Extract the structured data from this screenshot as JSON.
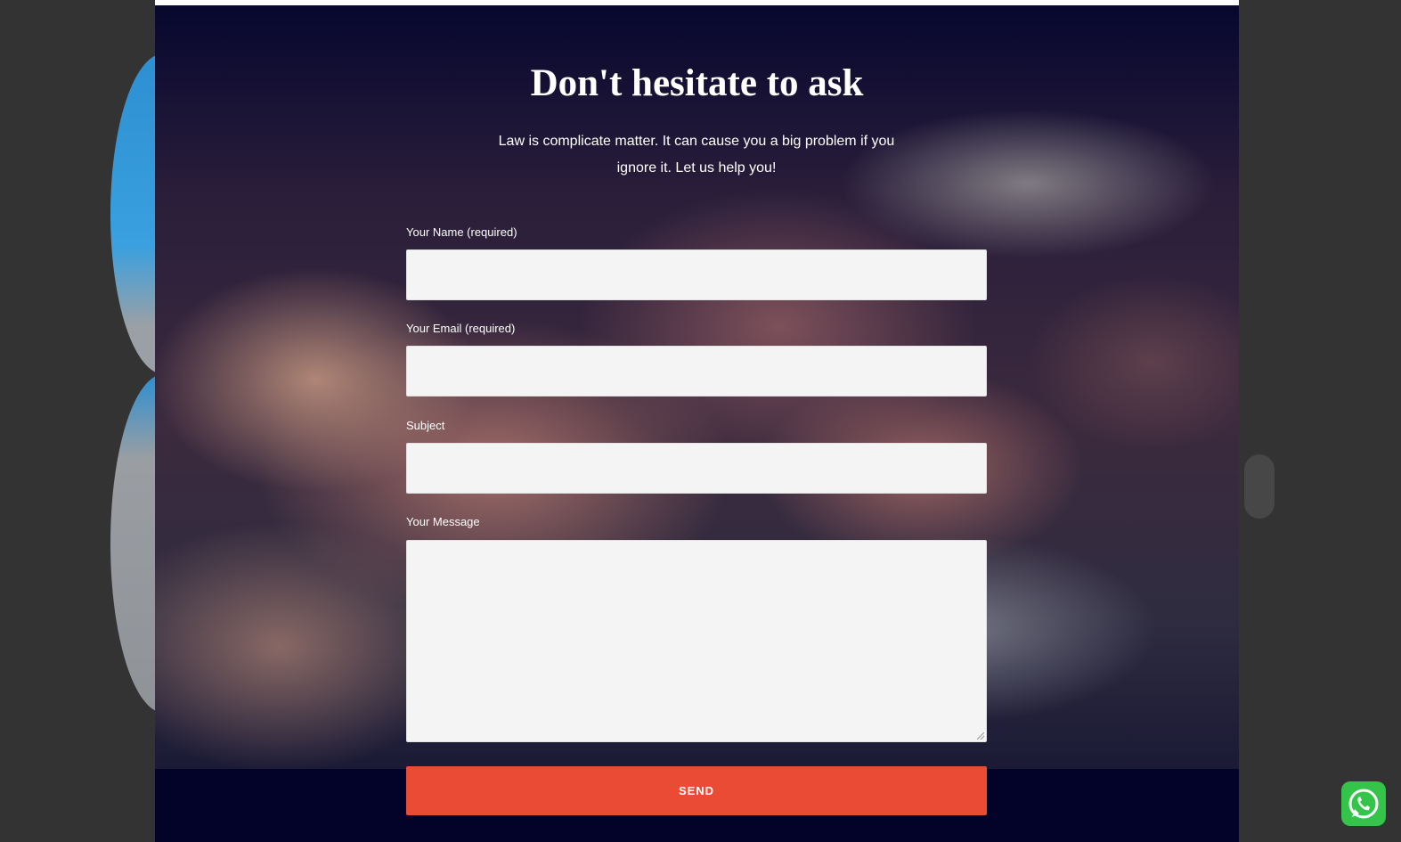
{
  "contact": {
    "heading": "Don't hesitate to ask",
    "intro": "Law is complicate matter. It can cause you a big problem if you ignore it. Let us help you!",
    "fields": {
      "name_label": "Your Name (required)",
      "email_label": "Your Email (required)",
      "subject_label": "Subject",
      "message_label": "Your Message"
    },
    "send_label": "SEND"
  },
  "icons": {
    "whatsapp": "whatsapp-icon"
  },
  "colors": {
    "panel_bg": "#03032a",
    "send_button": "#e94b35",
    "whatsapp": "#33c449",
    "field_bg": "#f4f4f4"
  }
}
